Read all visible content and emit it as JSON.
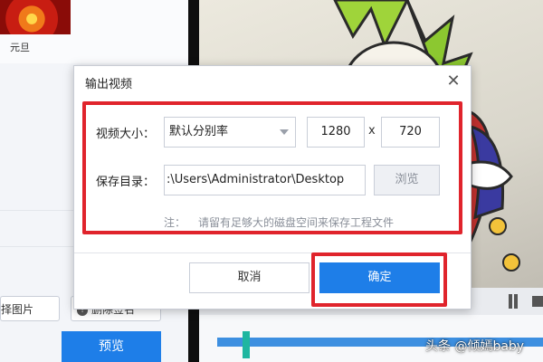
{
  "background": {
    "thumbnail_label": "元旦",
    "select_image_label": "选择图片",
    "delete_signature_label": "删除签名",
    "preview_label": "预览",
    "watermark_text": "头条 @倾嫣baby"
  },
  "dialog": {
    "title": "输出视频",
    "close_symbol": "✕",
    "size_label": "视频大小：",
    "resolution_selected": "默认分别率",
    "width_value": "1280",
    "times_symbol": "x",
    "height_value": "720",
    "dir_label": "保存目录：",
    "path_value": ":\\Users\\Administrator\\Desktop",
    "browse_label": "浏览",
    "note_prefix": "注：",
    "note_text": "请留有足够大的磁盘空间来保存工程文件",
    "cancel_label": "取消",
    "ok_label": "确定"
  },
  "colors": {
    "primary_button": "#1e7ee8",
    "highlight_box": "#e0242c",
    "timeline_track": "#3d8fe0",
    "timeline_handle": "#1fb6a0"
  },
  "icons": [
    "close-icon",
    "dropdown-caret-icon",
    "info-icon",
    "pause-icon",
    "stop-icon"
  ]
}
